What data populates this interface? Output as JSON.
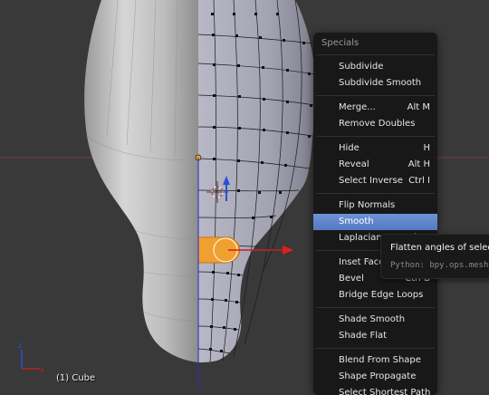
{
  "viewport": {
    "object_label": "(1) Cube",
    "axes": {
      "x": "x",
      "z": "z"
    }
  },
  "menu": {
    "title": "Specials",
    "groups": [
      [
        {
          "label": "Subdivide",
          "shortcut": ""
        },
        {
          "label": "Subdivide Smooth",
          "shortcut": ""
        }
      ],
      [
        {
          "label": "Merge...",
          "shortcut": "Alt M"
        },
        {
          "label": "Remove Doubles",
          "shortcut": ""
        }
      ],
      [
        {
          "label": "Hide",
          "shortcut": "H"
        },
        {
          "label": "Reveal",
          "shortcut": "Alt H"
        },
        {
          "label": "Select Inverse",
          "shortcut": "Ctrl I"
        }
      ],
      [
        {
          "label": "Flip Normals",
          "shortcut": ""
        },
        {
          "label": "Smooth",
          "shortcut": "",
          "active": true
        },
        {
          "label": "Laplacian Smooth",
          "shortcut": ""
        }
      ],
      [
        {
          "label": "Inset Faces",
          "shortcut": ""
        },
        {
          "label": "Bevel",
          "shortcut": "Ctrl B"
        },
        {
          "label": "Bridge Edge Loops",
          "shortcut": ""
        }
      ],
      [
        {
          "label": "Shade Smooth",
          "shortcut": ""
        },
        {
          "label": "Shade Flat",
          "shortcut": ""
        }
      ],
      [
        {
          "label": "Blend From Shape",
          "shortcut": ""
        },
        {
          "label": "Shape Propagate",
          "shortcut": ""
        },
        {
          "label": "Select Shortest Path",
          "shortcut": ""
        }
      ]
    ]
  },
  "tooltip": {
    "text": "Flatten angles of selecte",
    "python": "Python: bpy.ops.mesh"
  },
  "colors": {
    "background": "#393939",
    "highlight": "#5f86cf",
    "selection": "#f0a030",
    "axis_x": "#d02020",
    "axis_z": "#2a4fd8"
  }
}
